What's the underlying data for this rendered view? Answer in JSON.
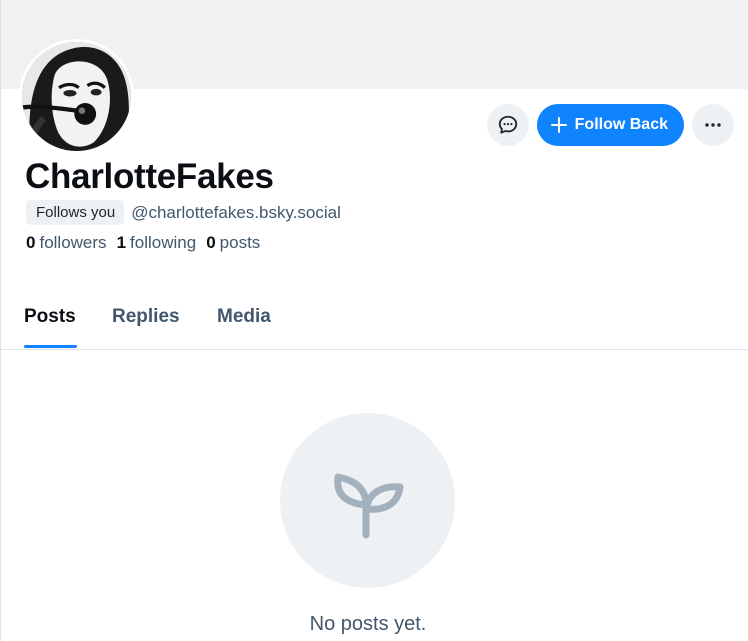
{
  "profile": {
    "display_name": "CharlotteFakes",
    "follows_you_badge": "Follows you",
    "handle": "@charlottefakes.bsky.social"
  },
  "stats": {
    "followers_count": "0",
    "followers_label": "followers",
    "following_count": "1",
    "following_label": "following",
    "posts_count": "0",
    "posts_label": "posts"
  },
  "actions": {
    "follow_back_label": "Follow Back",
    "message_icon": "chat-bubble-icon",
    "more_icon": "ellipsis-icon"
  },
  "tabs": [
    {
      "label": "Posts",
      "active": true
    },
    {
      "label": "Replies",
      "active": false
    },
    {
      "label": "Media",
      "active": false
    }
  ],
  "empty_state": {
    "icon": "sprout-icon",
    "text": "No posts yet."
  },
  "colors": {
    "accent": "#1083fe",
    "banner": "#eff1f3",
    "muted_text": "#42576c",
    "icon_gray": "#a3b1bf"
  }
}
